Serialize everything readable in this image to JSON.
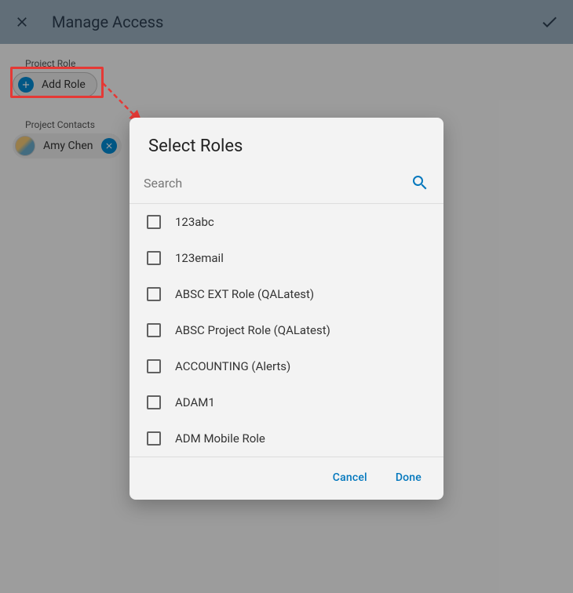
{
  "header": {
    "title": "Manage Access"
  },
  "sections": {
    "project_role_label": "Project Role",
    "add_role_label": "Add Role",
    "project_contacts_label": "Project Contacts"
  },
  "contacts": [
    {
      "name": "Amy Chen"
    }
  ],
  "dialog": {
    "title": "Select Roles",
    "search_placeholder": "Search",
    "roles": [
      {
        "label": "123abc",
        "checked": false
      },
      {
        "label": "123email",
        "checked": false
      },
      {
        "label": "ABSC EXT Role (QALatest)",
        "checked": false
      },
      {
        "label": "ABSC Project Role (QALatest)",
        "checked": false
      },
      {
        "label": "ACCOUNTING (Alerts)",
        "checked": false
      },
      {
        "label": "ADAM1",
        "checked": false
      },
      {
        "label": "ADM Mobile Role",
        "checked": false
      }
    ],
    "cancel_label": "Cancel",
    "done_label": "Done"
  },
  "colors": {
    "highlight": "#e53935",
    "primary": "#0277bd"
  }
}
